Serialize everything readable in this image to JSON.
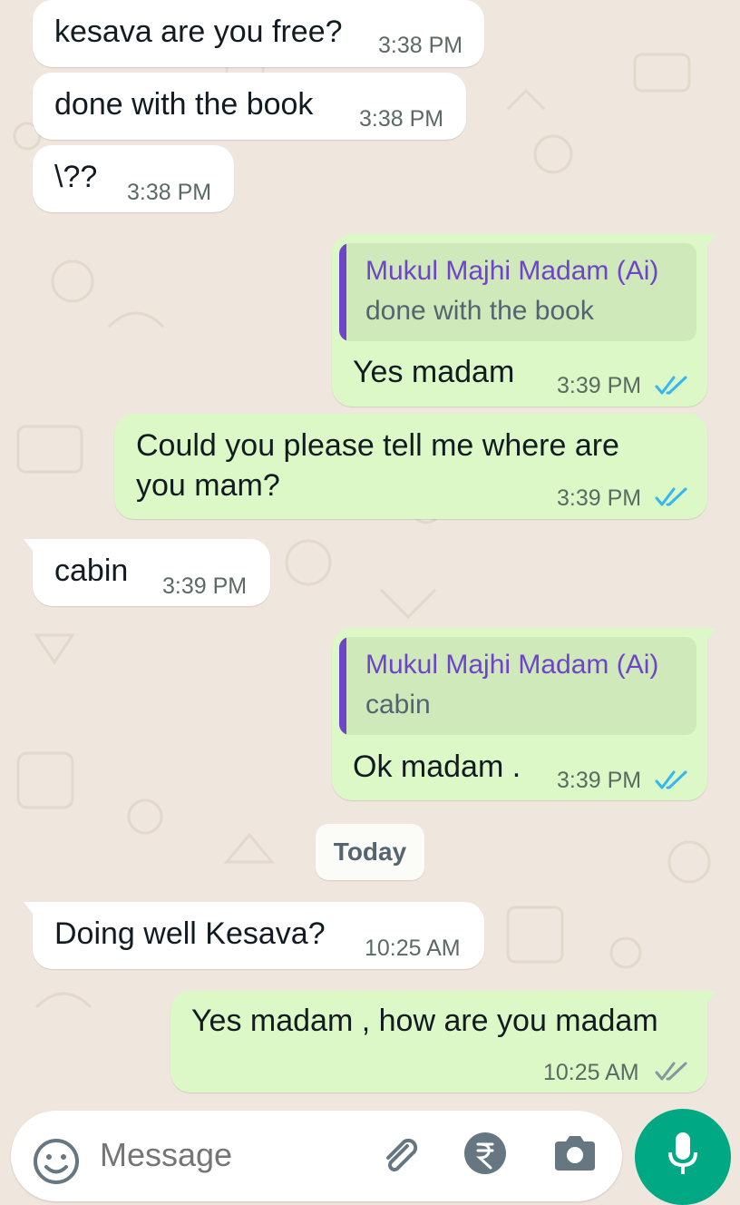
{
  "messages": [
    {
      "direction": "incoming",
      "text": "kesava are you free?",
      "time": "3:38 PM"
    },
    {
      "direction": "incoming",
      "text": "done with the book",
      "time": "3:38 PM"
    },
    {
      "direction": "incoming",
      "text": "\\??",
      "time": "3:38 PM"
    },
    {
      "direction": "outgoing",
      "quote": {
        "author": "Mukul Majhi Madam (Ai)",
        "text": "done with the book"
      },
      "text": "Yes madam",
      "time": "3:39 PM",
      "status": "read"
    },
    {
      "direction": "outgoing",
      "text_line1": "Could you please tell me where are",
      "text_line2": "you mam?",
      "time": "3:39 PM",
      "status": "read"
    },
    {
      "direction": "incoming",
      "text": "cabin",
      "time": "3:39 PM"
    },
    {
      "direction": "outgoing",
      "quote": {
        "author": "Mukul Majhi Madam (Ai)",
        "text": "cabin"
      },
      "text": "Ok madam .",
      "time": "3:39 PM",
      "status": "read"
    },
    {
      "direction": "incoming",
      "text": "Doing well Kesava?",
      "time": "10:25 AM"
    },
    {
      "direction": "outgoing",
      "text": "Yes madam , how are you madam",
      "time": "10:25 AM",
      "status": "delivered"
    }
  ],
  "date_separator": "Today",
  "composer": {
    "placeholder": "Message"
  },
  "icons": {
    "emoji": "emoji-icon",
    "attach": "paperclip-icon",
    "payment": "rupee-icon",
    "camera": "camera-icon",
    "mic": "microphone-icon",
    "read_ticks": "double-check-icon"
  },
  "colors": {
    "outgoing_bubble": "#dcf8c6",
    "incoming_bubble": "#ffffff",
    "read_ticks": "#34b7f1",
    "delivered_ticks": "#8696a0",
    "quote_accent": "#6e44c8",
    "mic_button": "#00a884",
    "background": "#efe7de"
  }
}
